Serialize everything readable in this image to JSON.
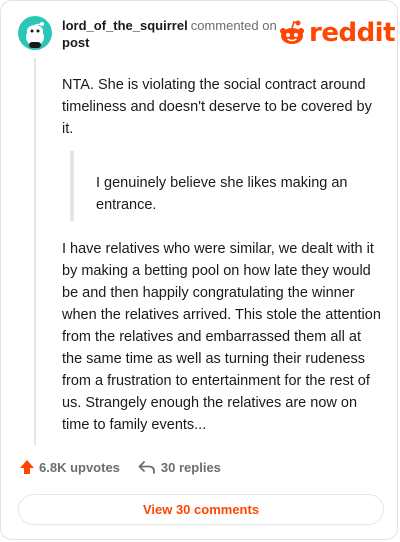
{
  "comment": {
    "username": "lord_of_the_squirrel",
    "action": "commented on",
    "target": "post",
    "paragraph1": "NTA. She is violating the social contract around timeliness and doesn't deserve to be covered by it.",
    "quote": "I genuinely believe she likes making an entrance.",
    "paragraph2": "I have relatives who were similar, we dealt with it by making a betting pool on how late they would be and then happily congratulating the winner when the relatives arrived. This stole the attention from the relatives and embarrassed them all at the same time as well as turning their rudeness from a frustration to entertainment for the rest of us. Strangely enough the relatives are now on time to family events..."
  },
  "logo": {
    "text": "reddit",
    "color": "#ff4500",
    "icon": "reddit-alien-icon"
  },
  "avatar": {
    "icon": "snoo-avatar-icon",
    "color": "#2ac6b8"
  },
  "footer": {
    "upvotes": "6.8K upvotes",
    "replies": "30 replies",
    "upvote_icon": "upvote-arrow-icon",
    "reply_icon": "reply-arrow-icon",
    "accent_color": "#ff4500"
  },
  "view_button": {
    "label": "View 30 comments"
  }
}
